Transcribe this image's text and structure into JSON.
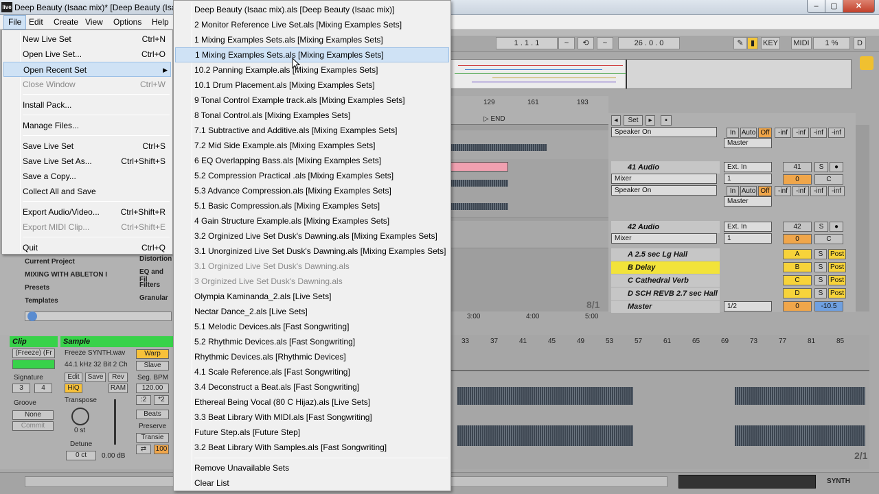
{
  "window": {
    "logo": "live",
    "title": "Deep Beauty (Isaac mix)*  [Deep Beauty (Isa",
    "controls": {
      "minimize": "–",
      "maximize": "▢",
      "close": "✕"
    }
  },
  "menubar": [
    "File",
    "Edit",
    "Create",
    "View",
    "Options",
    "Help"
  ],
  "file_menu": {
    "items": [
      {
        "label": "New Live Set",
        "shortcut": "Ctrl+N",
        "disabled": false
      },
      {
        "label": "Open Live Set...",
        "shortcut": "Ctrl+O",
        "disabled": false
      },
      {
        "label": "Open Recent Set",
        "shortcut": "",
        "disabled": false,
        "submenu": true
      },
      {
        "label": "Close Window",
        "shortcut": "Ctrl+W",
        "disabled": true
      },
      {
        "label": "Install Pack...",
        "shortcut": "",
        "disabled": false
      },
      {
        "label": "Manage Files...",
        "shortcut": "",
        "disabled": false
      },
      {
        "label": "Save Live Set",
        "shortcut": "Ctrl+S",
        "disabled": false
      },
      {
        "label": "Save Live Set As...",
        "shortcut": "Ctrl+Shift+S",
        "disabled": false
      },
      {
        "label": "Save a Copy...",
        "shortcut": "",
        "disabled": false
      },
      {
        "label": "Collect All and Save",
        "shortcut": "",
        "disabled": false
      },
      {
        "label": "Export Audio/Video...",
        "shortcut": "Ctrl+Shift+R",
        "disabled": false
      },
      {
        "label": "Export MIDI Clip...",
        "shortcut": "Ctrl+Shift+E",
        "disabled": true
      },
      {
        "label": "Quit",
        "shortcut": "Ctrl+Q",
        "disabled": false
      }
    ]
  },
  "recent_menu": {
    "items": [
      "Deep Beauty (Isaac mix).als  [Deep Beauty (Isaac mix)]",
      "2 Monitor Reference Live Set.als  [Mixing Examples Sets]",
      "1 Mixing Examples Sets.als  [Mixing Examples Sets]",
      "1 Mixing Examples Sets.als  [Mixing Examples Sets]",
      "10.2 Panning Example.als  [Mixing Examples Sets]",
      "10.1 Drum Placement.als  [Mixing Examples Sets]",
      "9 Tonal Control Example track.als  [Mixing Examples Sets]",
      "8 Tonal Control.als  [Mixing Examples Sets]",
      "7.1 Subtractive and Additive.als  [Mixing Examples Sets]",
      "7.2 Mid Side Example.als  [Mixing Examples Sets]",
      "6 EQ Overlapping Bass.als  [Mixing Examples Sets]",
      "5.2 Compression Practical .als  [Mixing Examples Sets]",
      "5.3 Advance Compression.als  [Mixing Examples Sets]",
      "5.1 Basic Compression.als  [Mixing Examples Sets]",
      "4 Gain Structure Example.als  [Mixing Examples Sets]",
      "3.2 Orginized Live Set Dusk's Dawning.als  [Mixing Examples Sets]",
      "3.1 Unorginized Live Set Dusk's Dawning.als  [Mixing Examples Sets]",
      "3.1 Orginized Live Set Dusk's Dawning.als",
      "3 Orginized Live Set Dusk's Dawning.als",
      "Olympia Kaminanda_2.als  [Live Sets]",
      "Nectar Dance_2.als  [Live Sets]",
      "5.1 Melodic Devices.als  [Fast Songwriting]",
      "5.2 Rhythmic Devices.als  [Fast Songwriting]",
      "Rhythmic Devices.als  [Rhythmic Devices]",
      "4.1 Scale Reference.als  [Fast Songwriting]",
      "3.4 Deconstruct a Beat.als  [Fast Songwriting]",
      "Ethereal Being Vocal (80 C Hijaz).als  [Live Sets]",
      "3.3 Beat Library With MIDI.als  [Fast Songwriting]",
      "Future Step.als  [Future Step]",
      "3.2 Beat Library With Samples.als  [Fast Songwriting]"
    ],
    "disabled_indices": [
      17,
      18
    ],
    "highlight_index": 3,
    "footer": [
      "Remove Unavailable Sets",
      "Clear List"
    ]
  },
  "transport": {
    "position": "1 .  1 .  1",
    "loop_length": "26 .  0 .  0",
    "key": "KEY",
    "midi": "MIDI",
    "cpu": "1 %",
    "d": "D"
  },
  "arrangement": {
    "ruler": [
      "129",
      "161",
      "193"
    ],
    "end_marker": "END",
    "time_labels": [
      "3:00",
      "4:00",
      "5:00"
    ],
    "zoom": "8/1"
  },
  "mixer": {
    "set_label": "Set",
    "tracks": [
      {
        "name": "41 Audio",
        "input": "Ext. In",
        "number": "41",
        "sub1": "Mixer",
        "sub2": "Speaker On",
        "vol": "0",
        "pan": "C",
        "out": "Master"
      },
      {
        "name": "42 Audio",
        "input": "Ext. In",
        "number": "42",
        "sub1": "Mixer",
        "vol": "0",
        "pan": "C"
      }
    ],
    "monitor_in": "In",
    "monitor_auto": "Auto",
    "monitor_off": "Off",
    "meter": "-inf",
    "returns": [
      {
        "name": "A 2.5 sec Lg Hall",
        "letter": "A"
      },
      {
        "name": "B Delay",
        "letter": "B"
      },
      {
        "name": "C Cathedral Verb",
        "letter": "C"
      },
      {
        "name": "D SCH REVB 2.7 sec Hall",
        "letter": "D"
      }
    ],
    "master": {
      "name": "Master",
      "routing": "1/2",
      "vol": "0",
      "value": "-10.5"
    },
    "solo": "S",
    "post": "Post"
  },
  "browser": {
    "places": [
      "Current Project",
      "MIXING WITH ABLETON I",
      "Presets",
      "Templates"
    ],
    "categories": [
      "Distortion",
      "EQ and Fil",
      "Filters",
      "Granular"
    ]
  },
  "clip_view": {
    "clip_title": "Clip",
    "sample_title": "Sample",
    "clip_name": "(Freeze) (Fr",
    "file": "Freeze SYNTH.wav",
    "info": "44.1 kHz 32 Bit 2 Ch",
    "signature_label": "Signature",
    "sig_num": "3",
    "sig_den": "4",
    "groove_label": "Groove",
    "groove_value": "None",
    "commit": "Commit",
    "edit": "Edit",
    "save": "Save",
    "rev": "Rev",
    "hiq": "HiQ",
    "ram": "RAM",
    "warp": "Warp",
    "slave": "Slave",
    "seg_bpm_label": "Seg. BPM",
    "seg_bpm": "120.00",
    "transpose_label": "Transpose",
    "transpose": "0 st",
    "detune_label": "Detune",
    "detune": "0 ct",
    "gain": "0.00 dB",
    "warp_mode": "Beats",
    "preserve_label": "Preserve",
    "preserve": "Transie",
    "half": ":2",
    "double": "*2",
    "grain": "100"
  },
  "sample_editor": {
    "ruler": [
      "33",
      "37",
      "41",
      "45",
      "49",
      "53",
      "57",
      "61",
      "65",
      "69",
      "73",
      "77",
      "81",
      "85"
    ],
    "zoom": "2/1"
  },
  "statusbar": {
    "synth": "SYNTH"
  }
}
